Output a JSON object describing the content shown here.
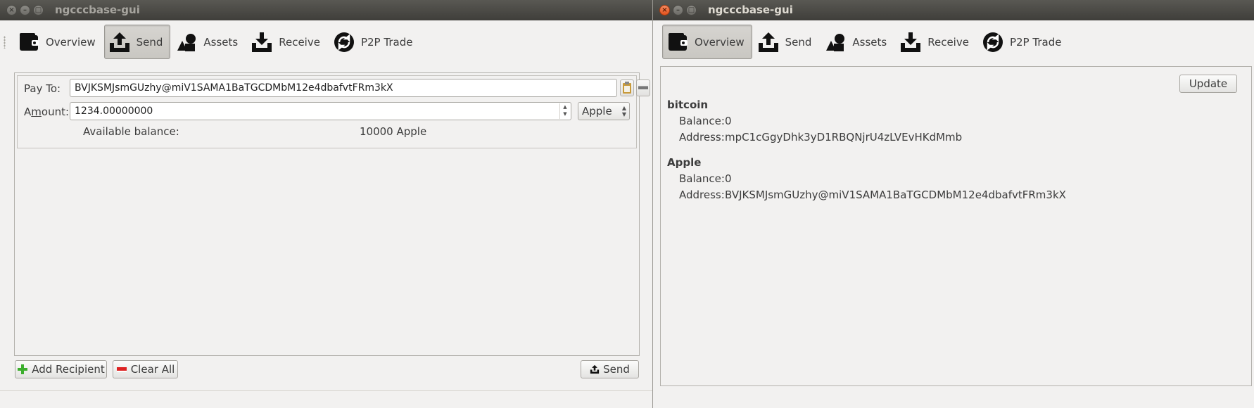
{
  "windows": {
    "left": {
      "title": "ngcccbase-gui",
      "toolbar": [
        "Overview",
        "Send",
        "Assets",
        "Receive",
        "P2P Trade"
      ],
      "active_tab": "Send",
      "send": {
        "pay_to_label": "Pay To:",
        "pay_to_value": "BVJKSMJsmGUzhy@miV1SAMA1BaTGCDMbM12e4dbafvtFRm3kX",
        "amount_label": "Amount:",
        "amount_value": "1234.00000000",
        "asset_selected": "Apple",
        "available_label": "Available balance:",
        "available_value": "10000 Apple",
        "add_recipient_label": "Add Recipient",
        "clear_all_label": "Clear All",
        "send_label": "Send"
      }
    },
    "right": {
      "title": "ngcccbase-gui",
      "toolbar": [
        "Overview",
        "Send",
        "Assets",
        "Receive",
        "P2P Trade"
      ],
      "active_tab": "Overview",
      "overview": {
        "update_label": "Update",
        "assets": [
          {
            "name": "bitcoin",
            "balance_label": "Balance:",
            "balance_value": "0",
            "address_label": "Address:",
            "address_value": "mpC1cGgyDhk3yD1RBQNjrU4zLVEvHKdMmb"
          },
          {
            "name": "Apple",
            "balance_label": "Balance:",
            "balance_value": "0",
            "address_label": "Address:",
            "address_value": "BVJKSMJsmGUzhy@miV1SAMA1BaTGCDMbM12e4dbafvtFRm3kX"
          }
        ]
      }
    }
  },
  "colors": {
    "window_bg": "#f2f1f0",
    "titlebar": "#3f3e3a",
    "close_button": "#e2521c",
    "panel_border": "#b3b1ac"
  },
  "icons": {
    "overview": "wallet-icon",
    "send": "send-tray-icon",
    "assets": "shapes-icon",
    "receive": "receive-tray-icon",
    "p2p": "exchange-arrows-icon"
  }
}
